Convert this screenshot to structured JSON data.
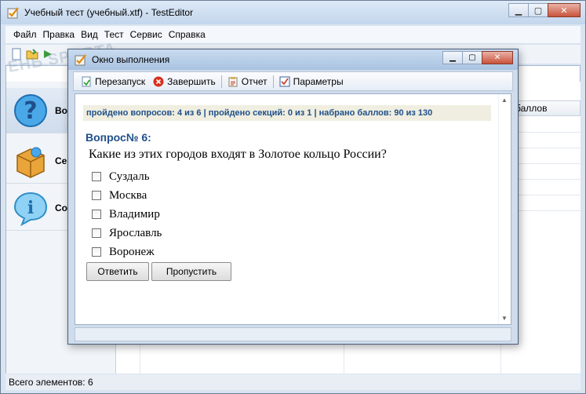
{
  "main_window": {
    "title": "Учебный тест (учебный.xtf) - TestEditor",
    "menu": [
      "Файл",
      "Правка",
      "Вид",
      "Тест",
      "Сервис",
      "Справка"
    ],
    "left_panel": [
      {
        "label": "Воп",
        "icon": "question-icon"
      },
      {
        "label": "Сек",
        "icon": "box-icon"
      },
      {
        "label": "Соо",
        "icon": "info-icon"
      }
    ],
    "grid_header": "о баллов",
    "status_text": "Всего элементов: 6"
  },
  "watermark": "ЕНЬ SPORTA",
  "dialog": {
    "title": "Окно выполнения",
    "toolbar": {
      "restart": "Перезапуск",
      "finish": "Завершить",
      "report": "Отчет",
      "params": "Параметры"
    },
    "stats": "пройдено вопросов: 4 из 6 | пройдено секций: 0 из 1 | набрано баллов: 90 из 130",
    "question_title": "Вопрос№ 6:",
    "question_text": "Какие из этих городов входят в Золотое кольцо России?",
    "options": [
      "Суздаль",
      "Москва",
      "Владимир",
      "Ярославль",
      "Воронеж"
    ],
    "answer_button": "Ответить",
    "skip_button": "Пропустить"
  }
}
